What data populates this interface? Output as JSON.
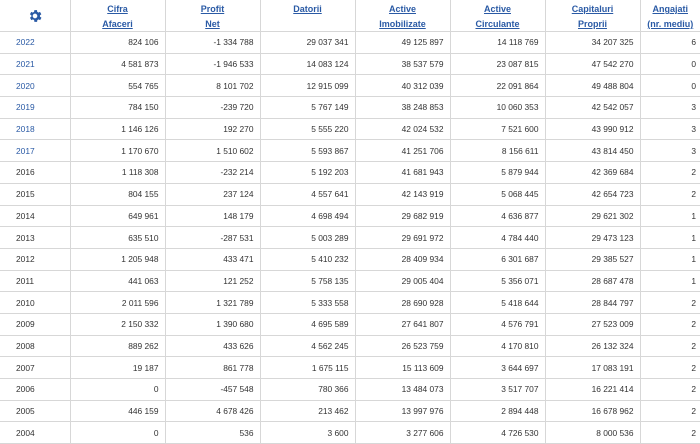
{
  "headers": [
    {
      "l1": "Cifra",
      "l2": "Afaceri"
    },
    {
      "l1": "Profit",
      "l2": "Net"
    },
    {
      "l1": "Datorii",
      "l2": ""
    },
    {
      "l1": "Active",
      "l2": "Imobilizate"
    },
    {
      "l1": "Active",
      "l2": "Circulante"
    },
    {
      "l1": "Capitaluri",
      "l2": "Proprii"
    },
    {
      "l1": "Angajati",
      "l2": "(nr. mediu)"
    }
  ],
  "colors": {
    "link": "#2a5aa5",
    "gear": "#2a5aa5"
  },
  "rows": [
    {
      "year": "2022",
      "link": true,
      "cifra": "824 106",
      "profit": "-1 334 788",
      "datorii": "29 037 341",
      "imob": "49 125 897",
      "circ": "14 118 769",
      "cap": "34 207 325",
      "ang": "6"
    },
    {
      "year": "2021",
      "link": true,
      "cifra": "4 581 873",
      "profit": "-1 946 533",
      "datorii": "14 083 124",
      "imob": "38 537 579",
      "circ": "23 087 815",
      "cap": "47 542 270",
      "ang": "0"
    },
    {
      "year": "2020",
      "link": true,
      "cifra": "554 765",
      "profit": "8 101 702",
      "datorii": "12 915 099",
      "imob": "40 312 039",
      "circ": "22 091 864",
      "cap": "49 488 804",
      "ang": "0"
    },
    {
      "year": "2019",
      "link": true,
      "cifra": "784 150",
      "profit": "-239 720",
      "datorii": "5 767 149",
      "imob": "38 248 853",
      "circ": "10 060 353",
      "cap": "42 542 057",
      "ang": "3"
    },
    {
      "year": "2018",
      "link": true,
      "cifra": "1 146 126",
      "profit": "192 270",
      "datorii": "5 555 220",
      "imob": "42 024 532",
      "circ": "7 521 600",
      "cap": "43 990 912",
      "ang": "3"
    },
    {
      "year": "2017",
      "link": true,
      "cifra": "1 170 670",
      "profit": "1 510 602",
      "datorii": "5 593 867",
      "imob": "41 251 706",
      "circ": "8 156 611",
      "cap": "43 814 450",
      "ang": "3"
    },
    {
      "year": "2016",
      "link": false,
      "cifra": "1 118 308",
      "profit": "-232 214",
      "datorii": "5 192 203",
      "imob": "41 681 943",
      "circ": "5 879 944",
      "cap": "42 369 684",
      "ang": "2"
    },
    {
      "year": "2015",
      "link": false,
      "cifra": "804 155",
      "profit": "237 124",
      "datorii": "4 557 641",
      "imob": "42 143 919",
      "circ": "5 068 445",
      "cap": "42 654 723",
      "ang": "2"
    },
    {
      "year": "2014",
      "link": false,
      "cifra": "649 961",
      "profit": "148 179",
      "datorii": "4 698 494",
      "imob": "29 682 919",
      "circ": "4 636 877",
      "cap": "29 621 302",
      "ang": "1"
    },
    {
      "year": "2013",
      "link": false,
      "cifra": "635 510",
      "profit": "-287 531",
      "datorii": "5 003 289",
      "imob": "29 691 972",
      "circ": "4 784 440",
      "cap": "29 473 123",
      "ang": "1"
    },
    {
      "year": "2012",
      "link": false,
      "cifra": "1 205 948",
      "profit": "433 471",
      "datorii": "5 410 232",
      "imob": "28 409 934",
      "circ": "6 301 687",
      "cap": "29 385 527",
      "ang": "1"
    },
    {
      "year": "2011",
      "link": false,
      "cifra": "441 063",
      "profit": "121 252",
      "datorii": "5 758 135",
      "imob": "29 005 404",
      "circ": "5 356 071",
      "cap": "28 687 478",
      "ang": "1"
    },
    {
      "year": "2010",
      "link": false,
      "cifra": "2 011 596",
      "profit": "1 321 789",
      "datorii": "5 333 558",
      "imob": "28 690 928",
      "circ": "5 418 644",
      "cap": "28 844 797",
      "ang": "2"
    },
    {
      "year": "2009",
      "link": false,
      "cifra": "2 150 332",
      "profit": "1 390 680",
      "datorii": "4 695 589",
      "imob": "27 641 807",
      "circ": "4 576 791",
      "cap": "27 523 009",
      "ang": "2"
    },
    {
      "year": "2008",
      "link": false,
      "cifra": "889 262",
      "profit": "433 626",
      "datorii": "4 562 245",
      "imob": "26 523 759",
      "circ": "4 170 810",
      "cap": "26 132 324",
      "ang": "2"
    },
    {
      "year": "2007",
      "link": false,
      "cifra": "19 187",
      "profit": "861 778",
      "datorii": "1 675 115",
      "imob": "15 113 609",
      "circ": "3 644 697",
      "cap": "17 083 191",
      "ang": "2"
    },
    {
      "year": "2006",
      "link": false,
      "cifra": "0",
      "profit": "-457 548",
      "datorii": "780 366",
      "imob": "13 484 073",
      "circ": "3 517 707",
      "cap": "16 221 414",
      "ang": "2"
    },
    {
      "year": "2005",
      "link": false,
      "cifra": "446 159",
      "profit": "4 678 426",
      "datorii": "213 462",
      "imob": "13 997 976",
      "circ": "2 894 448",
      "cap": "16 678 962",
      "ang": "2"
    },
    {
      "year": "2004",
      "link": false,
      "cifra": "0",
      "profit": "536",
      "datorii": "3 600",
      "imob": "3 277 606",
      "circ": "4 726 530",
      "cap": "8 000 536",
      "ang": "2"
    }
  ]
}
